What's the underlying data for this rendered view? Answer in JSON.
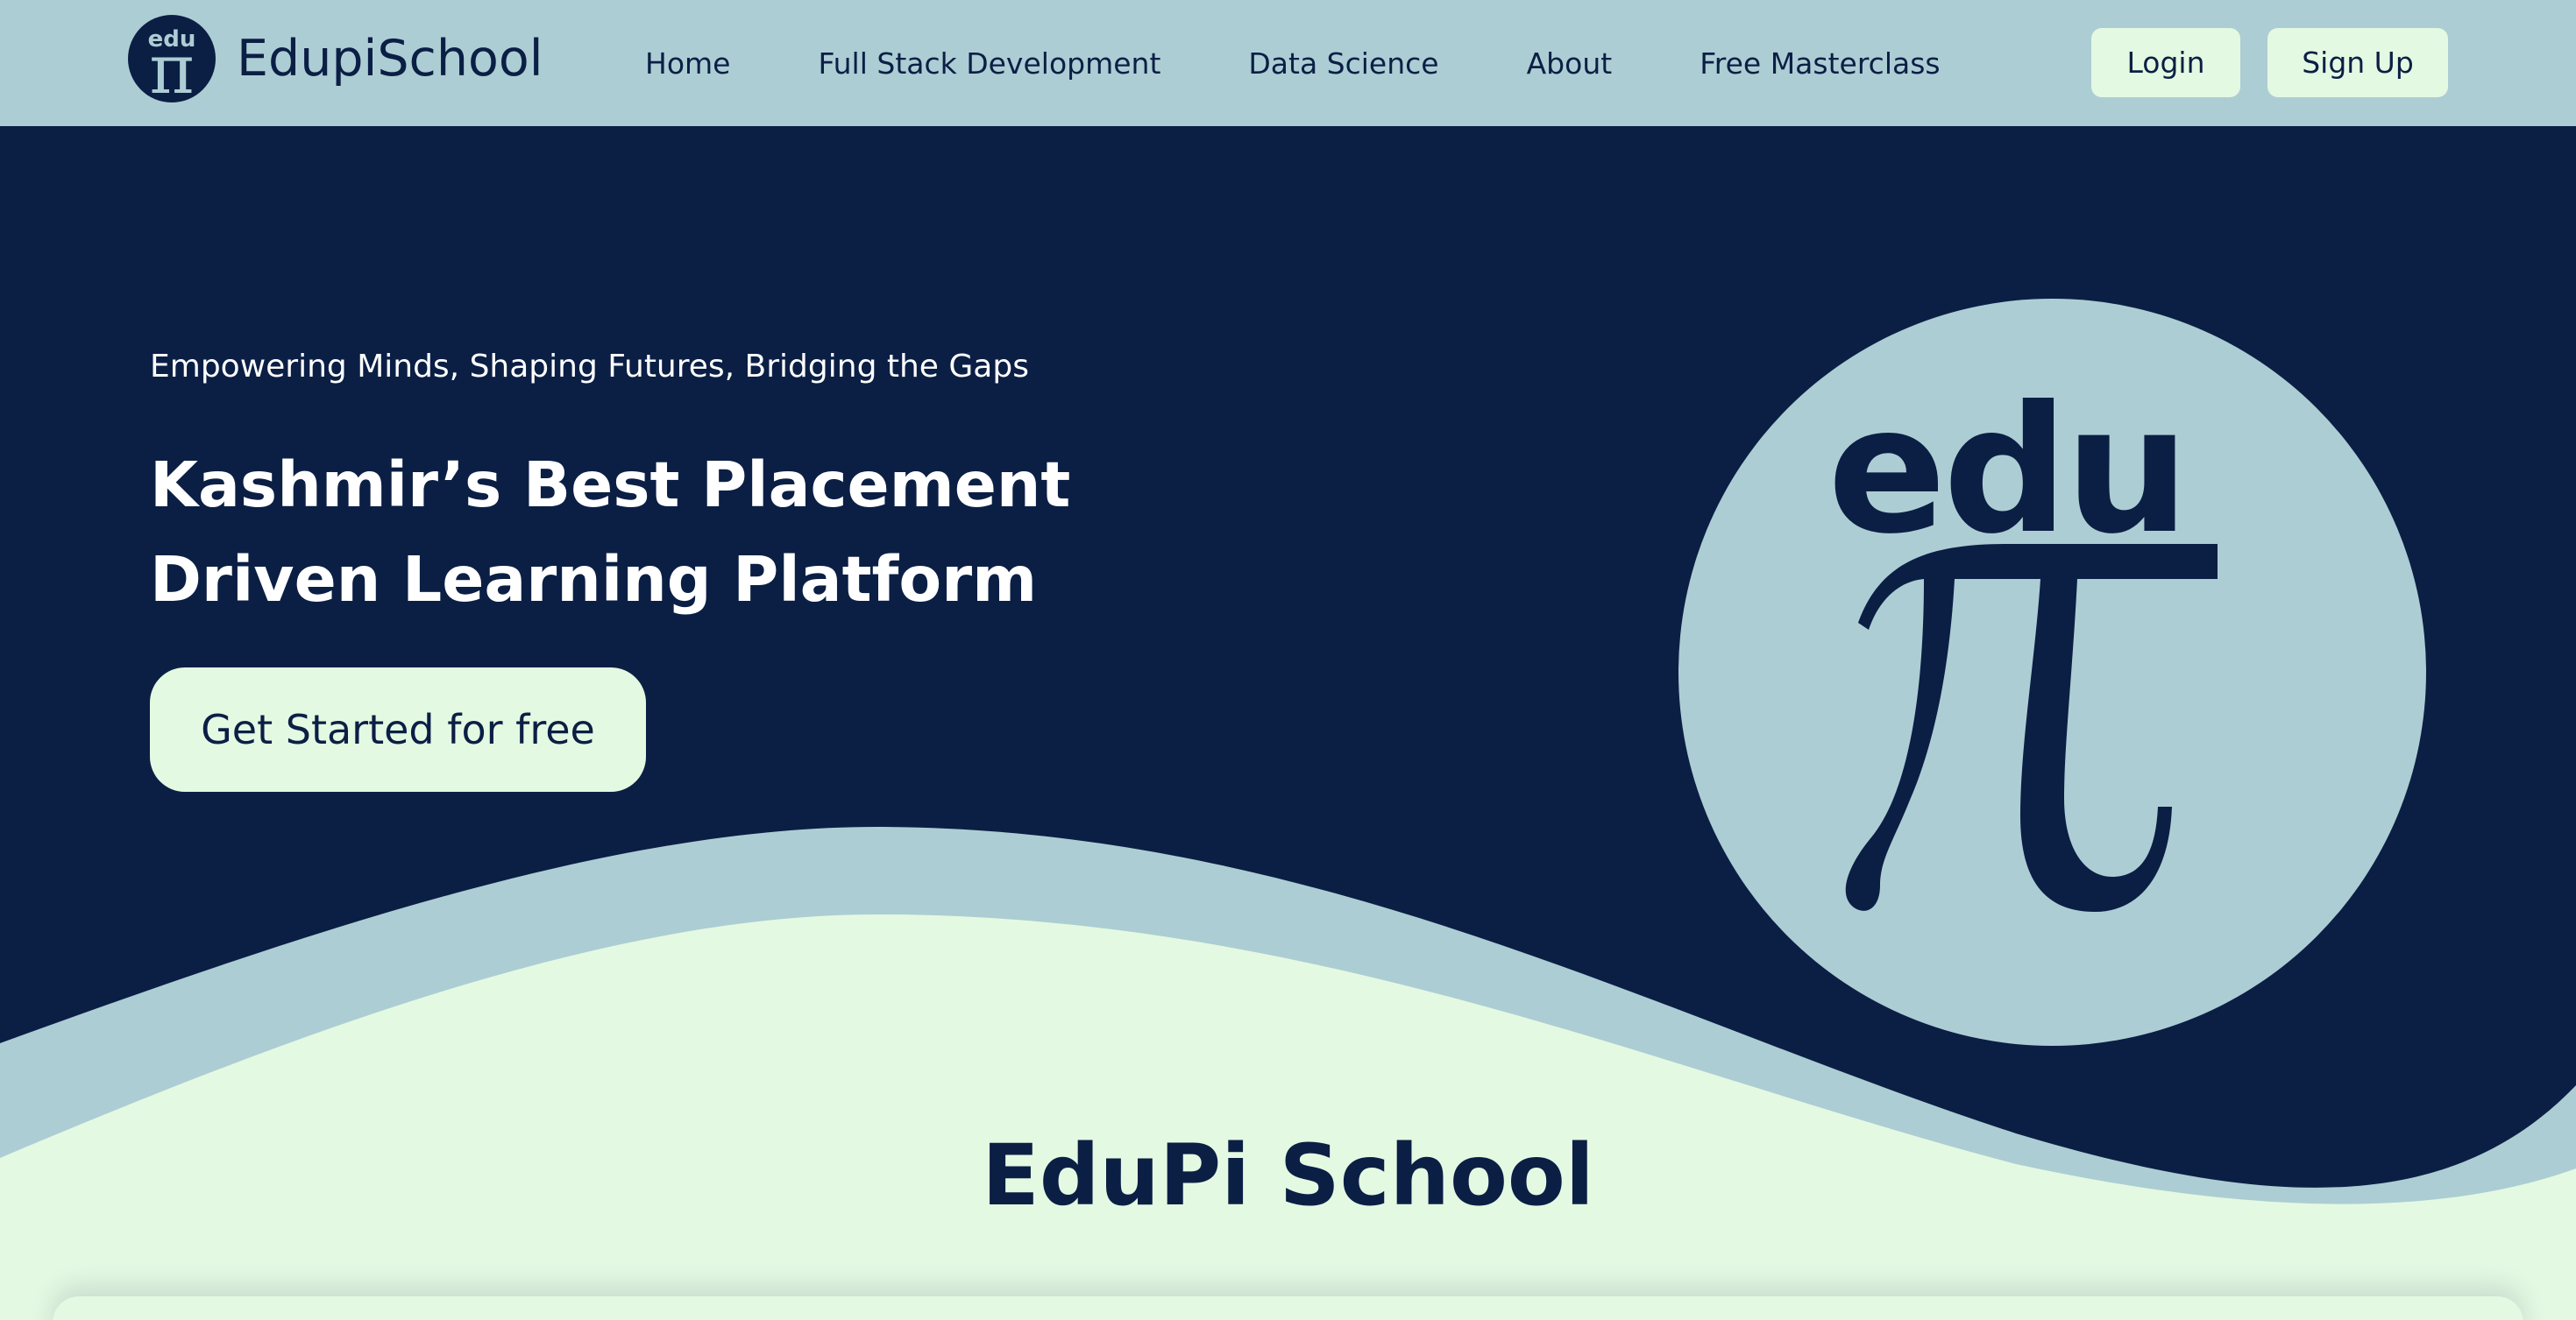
{
  "nav": {
    "logo_small_text": "edu",
    "logo_symbol": "π",
    "brand_name": "EdupiSchool",
    "links": [
      {
        "label": "Home"
      },
      {
        "label": "Full Stack Development"
      },
      {
        "label": "Data Science"
      },
      {
        "label": "About"
      },
      {
        "label": "Free Masterclass"
      }
    ],
    "login_label": "Login",
    "signup_label": "Sign Up"
  },
  "hero": {
    "tagline": "Empowering Minds, Shaping Futures, Bridging the Gaps",
    "title_line1": "Kashmir’s Best Placement",
    "title_line2": "Driven Learning Platform",
    "cta_label": "Get Started for free",
    "logo_word": "edu",
    "logo_symbol": "π"
  },
  "section": {
    "title": "EduPi School"
  },
  "colors": {
    "navy": "#0b1f45",
    "light_blue": "#adcdd4",
    "mint": "#e4f9e2",
    "white": "#ffffff"
  }
}
